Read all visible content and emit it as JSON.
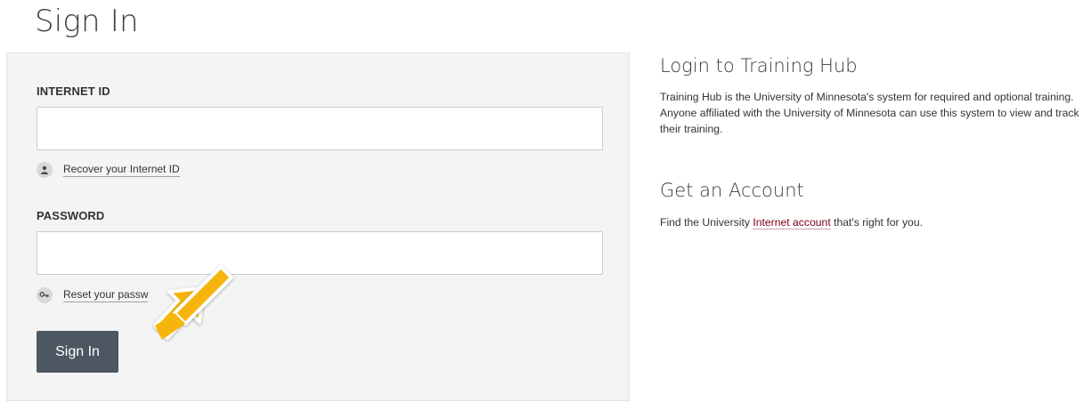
{
  "page": {
    "title": "Sign In"
  },
  "form": {
    "internet_id_label": "INTERNET ID",
    "internet_id_value": "",
    "recover_link": "Recover your Internet ID",
    "password_label": "PASSWORD",
    "password_value": "",
    "reset_link": "Reset your passw",
    "submit_label": "Sign In"
  },
  "sidebar": {
    "login_heading": "Login to Training Hub",
    "login_text": "Training Hub is the University of Minnesota's system for required and optional training. Anyone affiliated with the University of Minnesota can use this system to view and track their training.",
    "account_heading": "Get an Account",
    "account_text_before": "Find the University ",
    "account_link": "Internet account",
    "account_text_after": " that's right for you."
  },
  "icons": {
    "recover": "user-icon",
    "reset": "key-icon",
    "callout": "arrow-icon"
  },
  "colors": {
    "button": "#4c5762",
    "panel": "#f4f4f4",
    "arrow": "#f5b50a",
    "link": "#7a0019"
  }
}
